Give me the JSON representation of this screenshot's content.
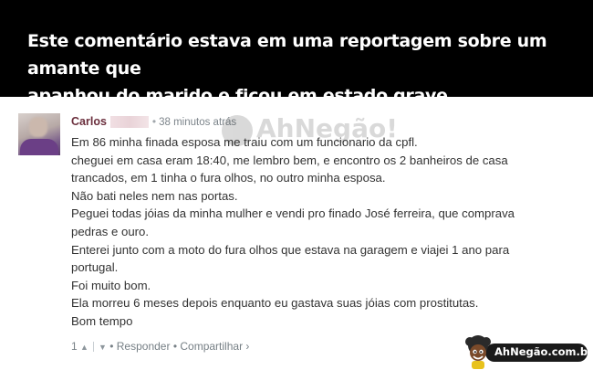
{
  "banner": {
    "line1": "Este comentário estava em uma reportagem sobre um amante que",
    "line2": "apanhou do marido e ficou em estado grave..."
  },
  "comment": {
    "author": "Carlos",
    "separator": "•",
    "time": "38 minutos atrás",
    "lines": [
      "Em 86 minha finada esposa me traiu com um funcionario da cpfl.",
      "cheguei em casa eram 18:40, me lembro bem, e encontro os 2 banheiros de casa",
      "trancados, em 1 tinha o fura olhos, no outro minha esposa.",
      "Não bati neles nem nas portas.",
      "Peguei todas jóias da minha mulher e vendi pro finado José ferreira, que comprava",
      "pedras e ouro.",
      "Enterei junto com a moto do fura olhos que estava na garagem e viajei 1 ano para",
      "portugal.",
      "Foi muito bom.",
      "Ela morreu 6 meses depois enquanto eu gastava suas jóias com prostitutas.",
      "Bom tempo"
    ],
    "actions": {
      "upvotes": "1",
      "upvote_icon": "chevron-up-icon",
      "downvote_icon": "chevron-down-icon",
      "dot": "•",
      "reply": "Responder",
      "share": "Compartilhar ›"
    }
  },
  "watermark": {
    "text": "AhNegão!"
  },
  "site_logo": {
    "text": "AhNegão.com.br"
  }
}
